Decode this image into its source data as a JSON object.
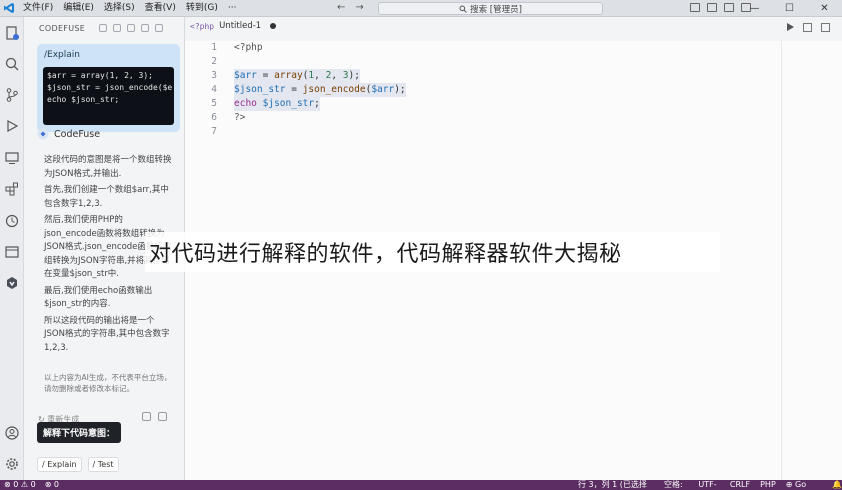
{
  "titlebar": {
    "menu": [
      "文件(F)",
      "编辑(E)",
      "选择(S)",
      "查看(V)",
      "转到(G)",
      "···"
    ],
    "nav_back": "←",
    "nav_forward": "→",
    "search": "搜索 [管理员]",
    "window_controls": [
      "—",
      "☐",
      "✕"
    ]
  },
  "side": {
    "header": "CODEFUSE",
    "card_title": "/Explain",
    "card_code": "$arr = array(1, 2, 3);\n$json_str = json_encode($e\necho $json_str;",
    "assistant_name": "CodeFuse",
    "answer": [
      "这段代码的意图是将一个数组转换为JSON格式,并输出.",
      "首先,我们创建一个数组$arr,其中包含数字1,2,3.",
      "然后,我们使用PHP的json_encode函数将数组转换为JSON格式.json_encode函数将数组转换为JSON字符串,并将其存储在变量$json_str中.",
      "最后,我们使用echo函数输出$json_str的内容.",
      "所以这段代码的输出将是一个JSON格式的字符串,其中包含数字1,2,3."
    ],
    "disclaimer": "以上内容为AI生成，不代表平台立场，请勿删除或者修改本标记。",
    "regenerate": "↻ 重新生成",
    "tooltip": "解释下代码意图：",
    "chips": [
      "/ Explain",
      "/ Test"
    ]
  },
  "editor": {
    "tab_icon": "<?php",
    "tab_name": "Untitled-1",
    "lines": [
      {
        "n": "1",
        "text": "<?php"
      },
      {
        "n": "2",
        "text": ""
      },
      {
        "n": "3",
        "text": "$arr = array(1, 2, 3);"
      },
      {
        "n": "4",
        "text": "$json_str = json_encode($arr);"
      },
      {
        "n": "5",
        "text": "echo $json_str;"
      },
      {
        "n": "6",
        "text": "?>"
      },
      {
        "n": "7",
        "text": ""
      }
    ]
  },
  "overlay": {
    "caption": "对代码进行解释的软件，代码解释器软件大揭秘"
  },
  "status": {
    "left": [
      "⊗ 0 ⚠ 0",
      "⊗ 0"
    ],
    "right": [
      "行 3，列 1 (已选择71)",
      "空格: 4",
      "UTF-8",
      "CRLF",
      "PHP",
      "⊕ Go Live",
      "🔔"
    ]
  },
  "colors": {
    "accent": "#5b2d62",
    "card_bg": "#cfe3f6"
  }
}
